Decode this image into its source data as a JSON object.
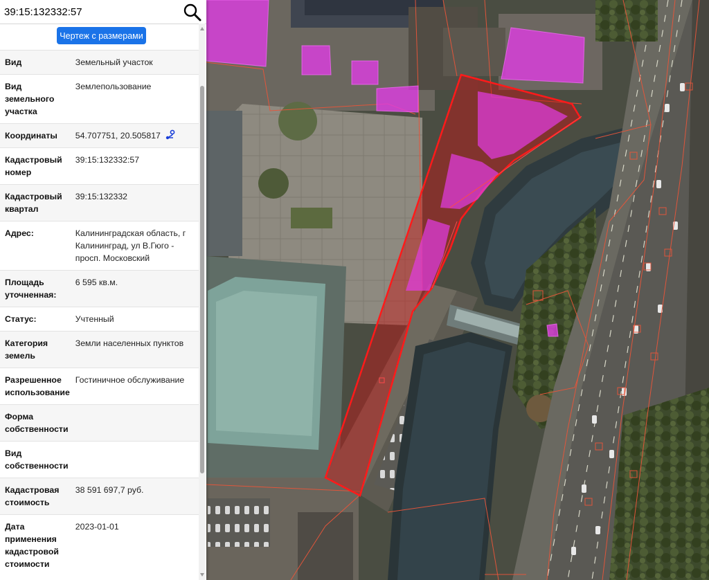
{
  "search": {
    "query": "39:15:132332:57"
  },
  "toolbar": {
    "drawing_button_label": "Чертеж с размерами"
  },
  "icons": {
    "search": "magnifier-icon",
    "coordinates": "route-pin-icon"
  },
  "colors": {
    "button_blue": "#1a73e8",
    "parcel_outline": "#ff1a1a",
    "parcel_fill": "#c81414",
    "building_highlight": "#e23ce6",
    "cadastral_lines": "#e8553a"
  },
  "attributes": [
    {
      "label": "Вид",
      "value": "Земельный участок"
    },
    {
      "label": "Вид земельного участка",
      "value": "Землепользование"
    },
    {
      "label": "Координаты",
      "value": "54.707751, 20.505817"
    },
    {
      "label": "Кадастровый номер",
      "value": "39:15:132332:57"
    },
    {
      "label": "Кадастровый квартал",
      "value": "39:15:132332"
    },
    {
      "label": "Адрес:",
      "value": "Калининградская область, г Калининград, ул В.Гюго - просп. Московский"
    },
    {
      "label": "Площадь уточненная:",
      "value": "6 595 кв.м."
    },
    {
      "label": "Статус:",
      "value": "Учтенный"
    },
    {
      "label": "Категория земель",
      "value": "Земли населенных пунктов"
    },
    {
      "label": "Разрешенное использование",
      "value": "Гостиничное обслуживание"
    },
    {
      "label": "Форма собственности",
      "value": ""
    },
    {
      "label": "Вид собственности",
      "value": ""
    },
    {
      "label": "Кадастровая стоимость",
      "value": "38 591 697,7 руб."
    },
    {
      "label": "Дата применения кадастровой стоимости",
      "value": "2023-01-01"
    }
  ]
}
